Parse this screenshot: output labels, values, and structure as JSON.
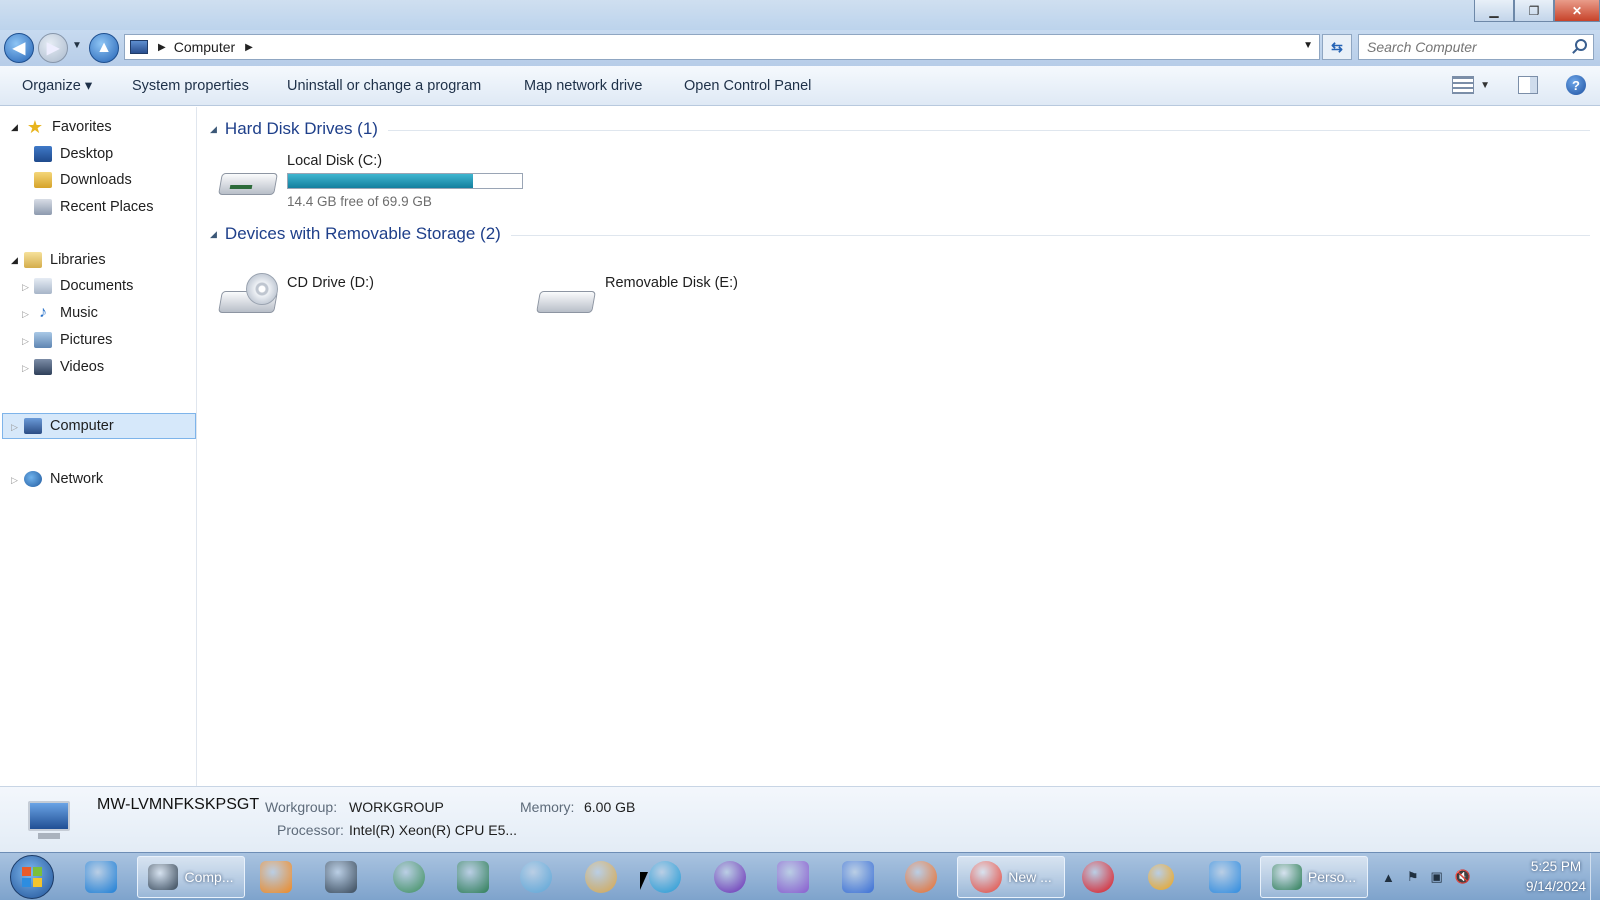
{
  "window": {
    "buttons": {
      "minimize": "▁",
      "restore": "❐",
      "close": "✕"
    }
  },
  "address": {
    "crumbs": [
      "Computer"
    ],
    "search_placeholder": "Search Computer"
  },
  "toolbar": {
    "organize": "Organize ▾",
    "system_properties": "System properties",
    "uninstall": "Uninstall or change a program",
    "map_network": "Map network drive",
    "control_panel": "Open Control Panel"
  },
  "sidebar": {
    "favorites": {
      "label": "Favorites",
      "items": [
        "Desktop",
        "Downloads",
        "Recent Places"
      ]
    },
    "libraries": {
      "label": "Libraries",
      "items": [
        "Documents",
        "Music",
        "Pictures",
        "Videos"
      ]
    },
    "computer": "Computer",
    "network": "Network"
  },
  "groups": {
    "hdd": {
      "title": "Hard Disk Drives (1)",
      "drives": [
        {
          "name": "Local Disk (C:)",
          "usage_text": "14.4 GB free of 69.9 GB",
          "used_fraction": 0.79
        }
      ]
    },
    "removable": {
      "title": "Devices with Removable Storage (2)",
      "drives": [
        {
          "name": "CD Drive (D:)"
        },
        {
          "name": "Removable Disk (E:)"
        }
      ]
    }
  },
  "details": {
    "computer_name": "MW-LVMNFKSKPSGT",
    "workgroup_label": "Workgroup:",
    "workgroup_value": "WORKGROUP",
    "memory_label": "Memory:",
    "memory_value": "6.00 GB",
    "processor_label": "Processor:",
    "processor_value": "Intel(R) Xeon(R) CPU E5..."
  },
  "taskbar": {
    "explorer_label": "Comp...",
    "chrome_label": "New ...",
    "person_label": "Perso...",
    "time": "5:25 PM",
    "date": "9/14/2024",
    "colors": {
      "ie": "#1e7fd6",
      "media": "#f08a24",
      "terminal": "#3a4a5a",
      "globe": "#3b8f5a",
      "sheet": "#2f7f57",
      "people": "#5aa6d8",
      "paint": "#d9a84a",
      "edge": "#1d9ad6",
      "yahoo": "#6a2bb5",
      "vs": "#8a5cd0",
      "feather": "#3a6fd6",
      "firefox": "#ef6a24",
      "chrome": "#ea4335",
      "opera": "#e0131b",
      "ring": "#f2a516",
      "winflag": "#2f8ce0"
    }
  }
}
